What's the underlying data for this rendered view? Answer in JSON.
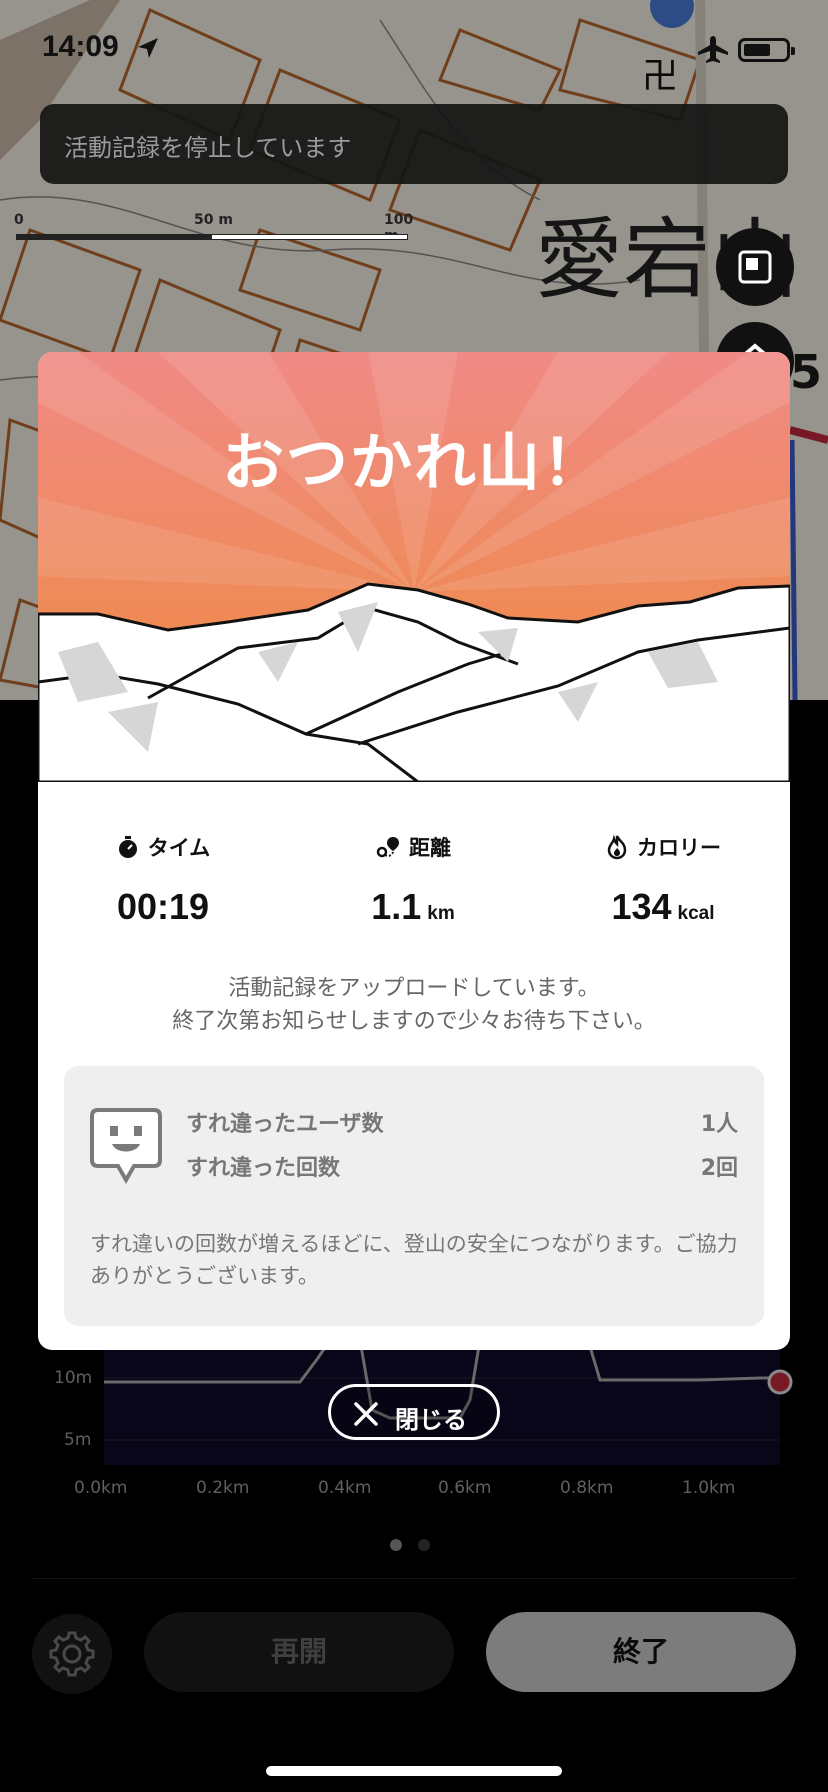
{
  "status": {
    "time": "14:09"
  },
  "toast": {
    "text": "活動記録を停止しています"
  },
  "map": {
    "scale_labels": [
      "0",
      "50 m",
      "100 m"
    ],
    "place_label": "愛宕山",
    "badge_number": "5"
  },
  "modal": {
    "title": "おつかれ山！",
    "stats": {
      "time": {
        "label": "タイム",
        "value": "00:19",
        "icon": "stopwatch-icon"
      },
      "distance": {
        "label": "距離",
        "value": "1.1",
        "unit": "km",
        "icon": "route-icon"
      },
      "calories": {
        "label": "カロリー",
        "value": "134",
        "unit": "kcal",
        "icon": "flame-icon"
      }
    },
    "notice_line1": "活動記録をアップロードしています。",
    "notice_line2": "終了次第お知らせしますので少々お待ち下さい。",
    "passing": {
      "users_label": "すれ違ったユーザ数",
      "users_value": "1人",
      "count_label": "すれ違った回数",
      "count_value": "2回",
      "note": "すれ違いの回数が増えるほどに、登山の安全につながります。ご協力ありがとうございます。"
    },
    "close_label": "閉じる"
  },
  "chart": {
    "y_ticks": [
      "10m",
      "5m"
    ],
    "x_ticks": [
      "0.0km",
      "0.2km",
      "0.4km",
      "0.6km",
      "0.8km",
      "1.0km"
    ]
  },
  "controls": {
    "resume_label": "再開",
    "finish_label": "終了"
  },
  "colors": {
    "hero_top": "#f08a86",
    "hero_bottom": "#ee8a38",
    "accent_red": "#c0283a"
  }
}
